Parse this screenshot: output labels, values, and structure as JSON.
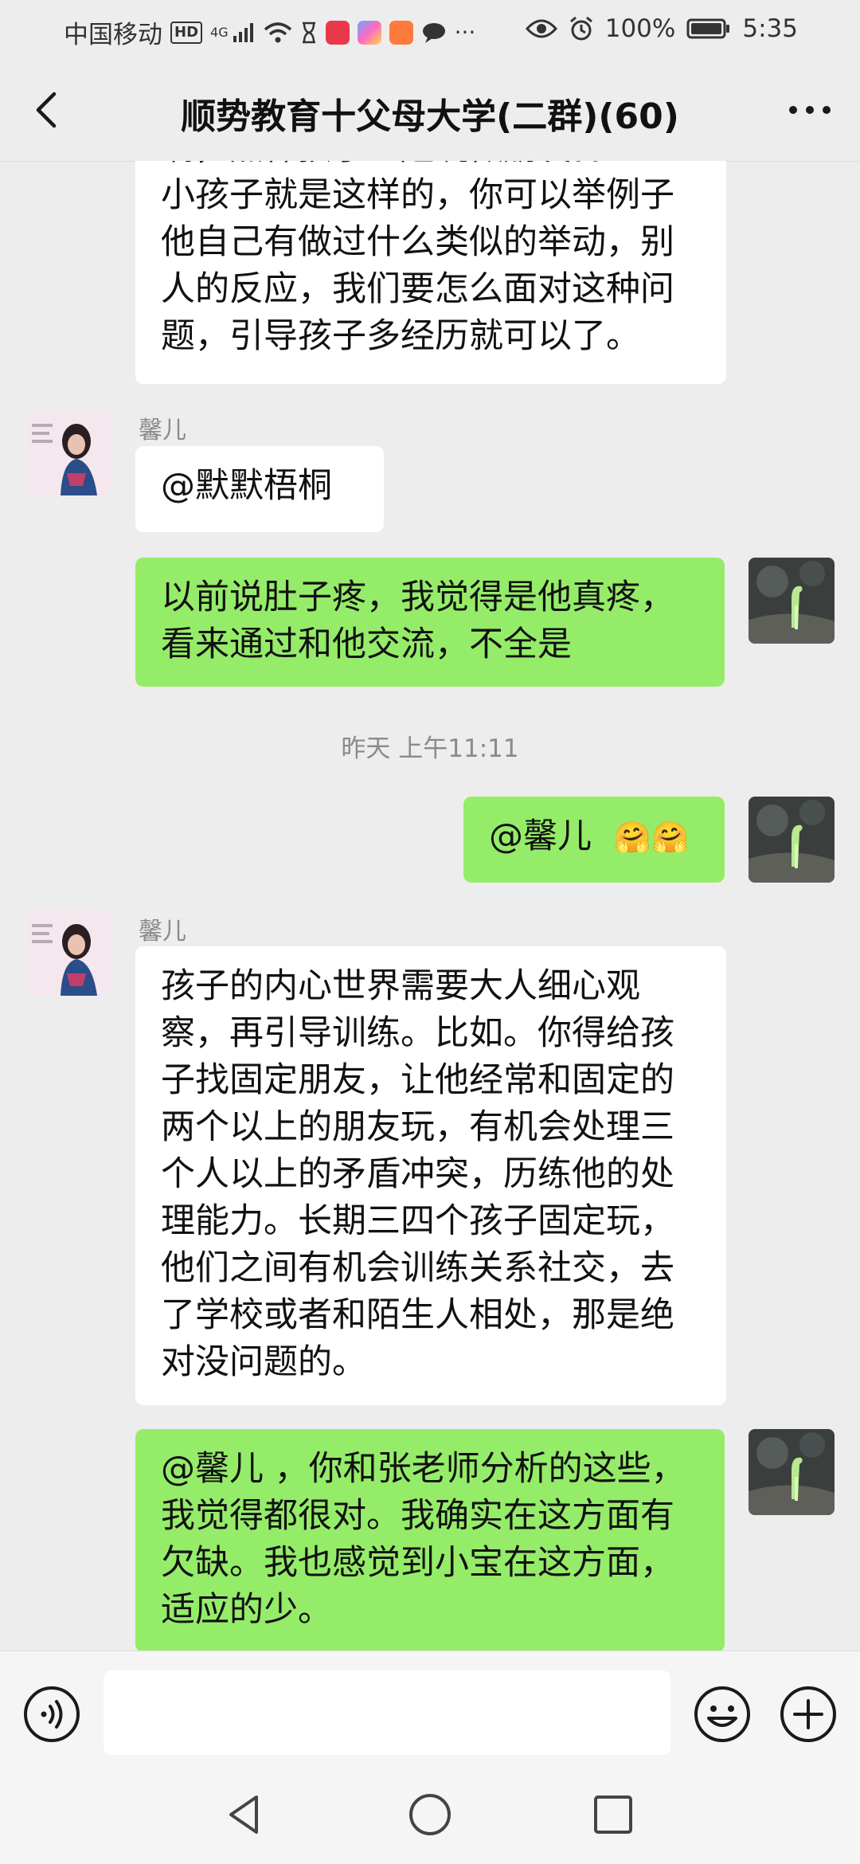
{
  "status_bar": {
    "carrier": "中国移动",
    "hd": "HD",
    "network": "4G",
    "battery": "100%",
    "time": "5:35"
  },
  "header": {
    "title": "顺势教育十父母大学(二群)(60)"
  },
  "messages": [
    {
      "side": "in",
      "lines": [
        "啊，点样孩子一起玩做朋友。。",
        "小孩子就是这样的，你可以举例子",
        "他自己有做过什么类似的举动，别",
        "人的反应，我们要怎么面对这种问",
        "题，引导孩子多经历就可以了。"
      ]
    },
    {
      "side": "in",
      "sender": "馨儿",
      "lines": [
        "@默默梧桐"
      ]
    },
    {
      "side": "out",
      "lines": [
        "以前说肚子疼，我觉得是他真疼，",
        "看来通过和他交流，不全是"
      ]
    },
    {
      "side": "out",
      "lines": [
        "@馨儿"
      ],
      "emoji": "🤗🤗"
    },
    {
      "side": "in",
      "sender": "馨儿",
      "lines": [
        "孩子的内心世界需要大人细心观",
        "察，再引导训练。比如。你得给孩",
        "子找固定朋友，让他经常和固定的",
        "两个以上的朋友玩，有机会处理三",
        "个人以上的矛盾冲突，历练他的处",
        "理能力。长期三四个孩子固定玩，",
        "他们之间有机会训练关系社交，去",
        "了学校或者和陌生人相处，那是绝",
        "对没问题的。"
      ]
    },
    {
      "side": "out",
      "lines": [
        "@馨儿 ，你和张老师分析的这些，",
        "我觉得都很对。我确实在这方面有",
        "欠缺。我也感觉到小宝在这方面，",
        "适应的少。"
      ]
    }
  ],
  "timestamp": "昨天 上午11:11",
  "icons": {
    "back": "chevron-left-icon",
    "more": "more-dots-icon",
    "voice": "voice-icon",
    "emoji": "emoji-icon",
    "plus": "plus-icon"
  },
  "colors": {
    "background": "#ededed",
    "outgoing_bubble": "#95ec69",
    "incoming_bubble": "#ffffff"
  }
}
